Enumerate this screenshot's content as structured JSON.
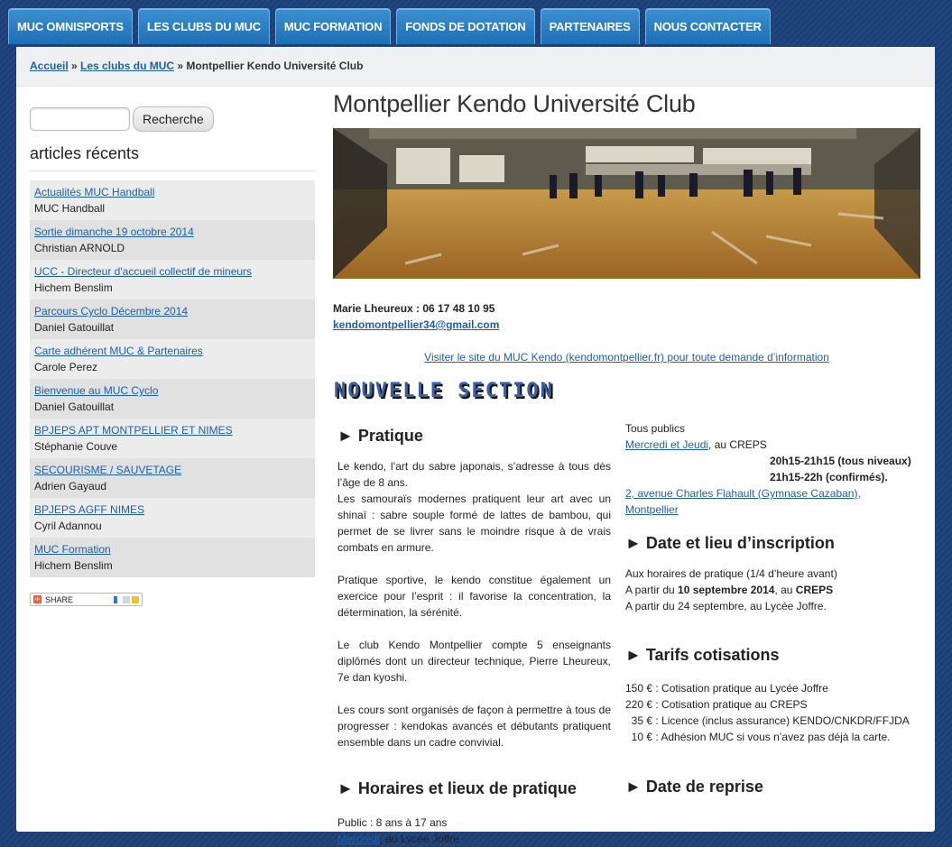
{
  "nav": [
    "MUC OMNISPORTS",
    "LES CLUBS DU MUC",
    "MUC FORMATION",
    "FONDS DE DOTATION",
    "PARTENAIRES",
    "NOUS CONTACTER"
  ],
  "breadcrumb": {
    "home": "Accueil",
    "sep": "»",
    "section": "Les clubs du MUC",
    "current": "Montpellier Kendo Université Club"
  },
  "sidebar": {
    "search_button": "Recherche",
    "widget_title": "articles récents",
    "recent": [
      {
        "title": "Actualités MUC Handball",
        "author": "MUC Handball"
      },
      {
        "title": "Sortie dimanche 19 octobre 2014",
        "author": "Christian ARNOLD"
      },
      {
        "title": "UCC - Directeur d'accueil collectif de mineurs",
        "author": "Hichem Benslim"
      },
      {
        "title": "Parcours Cyclo Décembre 2014",
        "author": "Daniel Gatouillat"
      },
      {
        "title": "Carte adhérent MUC & Partenaires",
        "author": "Carole Perez"
      },
      {
        "title": "Bienvenue au MUC Cyclo",
        "author": "Daniel Gatouillat"
      },
      {
        "title": "BPJEPS APT MONTPELLIER ET NIMES",
        "author": "Stéphanie Couve"
      },
      {
        "title": "SECOURISME / SAUVETAGE",
        "author": "Adrien Gayaud"
      },
      {
        "title": "BPJEPS AGFF NIMES",
        "author": "Cyril Adannou"
      },
      {
        "title": "MUC Formation",
        "author": "Hichem Benslim"
      }
    ],
    "share_label": "SHARE"
  },
  "content": {
    "title": "Montpellier Kendo Université Club",
    "contact_line": "Marie Lheureux : 06 17 48 10 95",
    "email": "kendomontpellier34@gmail.com",
    "visit_link": "Visiter le site du MUC Kendo (kendomontpellier.fr) pour toute demande d’information",
    "nouvelle": "NOUVELLE SECTION",
    "pratique_title": "► Pratique",
    "pratique_p1": "Le kendo, l’art du sabre japonais, s’adresse à tous dès l’âge de 8 ans.",
    "pratique_p1b": "Les samouraïs modernes pratiquent leur art avec un shinaï : sabre souple formé de lattes de bambou, qui permet de se livrer sans le moindre risque à de vrais combats en armure.",
    "pratique_p2": "Pratique sportive, le kendo constitue également un exercice pour l’esprit : il favorise la concentration, la détermination, la sérénité.",
    "pratique_p3": "Le club Kendo Montpellier compte 5 enseignants diplômés dont un directeur technique, Pierre Lheureux, 7e dan kyoshi.",
    "pratique_p4": "Les cours sont organisés de façon à permettre à tous de progresser : kendokas avancés et débutants pratiquent ensemble dans un cadre convivial.",
    "horaires_title": "► Horaires et lieux de pratique",
    "horaires_public": "Public : 8 ans à 17 ans",
    "horaires_day_link": "Mercredi",
    "horaires_day_rest": ", au Lycée Joffre",
    "right_public": "Tous publics",
    "right_days_link": "Mercredi et Jeudi",
    "right_days_rest": ", au CREPS",
    "time1": "20h15-21h15 (tous niveaux)",
    "time2": "21h15-22h (confirmés).",
    "address_link": "2, avenue Charles Flahault (Gymnase Cazaban), Montpellier",
    "inscription_title": "► Date et lieu d’inscription",
    "inscr_1": "Aux horaires de pratique (1/4 d’heure avant)",
    "inscr_2_a": "A partir du ",
    "inscr_2_b": "10 septembre 2014",
    "inscr_2_c": ", au ",
    "inscr_2_d": "CREPS",
    "inscr_3": "A partir du 24 septembre, au Lycée Joffre.",
    "tarifs_title": "► Tarifs cotisations",
    "tarifs": [
      "150 € : Cotisation pratique au Lycée Joffre",
      "220 € : Cotisation pratique au CREPS",
      "  35 € : Licence (inclus assurance) KENDO/CNKDR/FFJDA",
      "  10 € : Adhésion MUC si vous n’avez pas déjà la carte."
    ],
    "reprise_title": "► Date de reprise"
  }
}
